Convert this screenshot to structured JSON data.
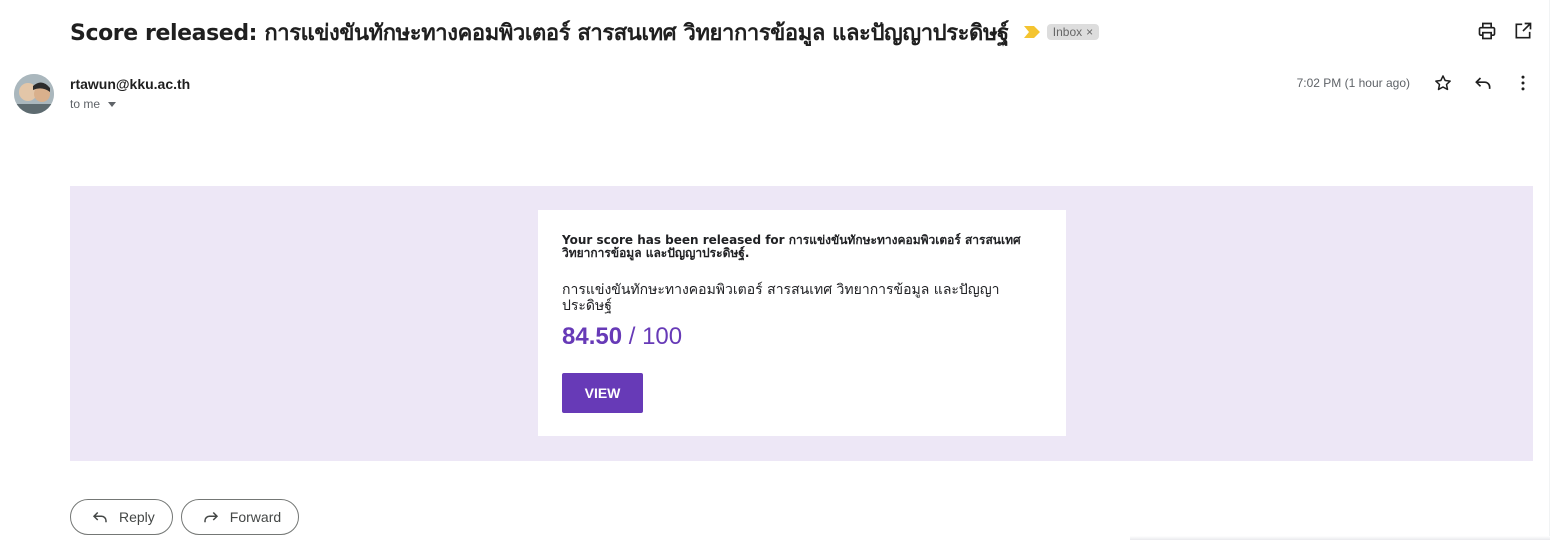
{
  "email": {
    "subject": "Score released: การแข่งขันทักษะทางคอมพิวเตอร์ สารสนเทศ วิทยาการข้อมูล และปัญญาประดิษฐ์",
    "label_chip": "Inbox",
    "label_remove": "×",
    "sender": "rtawun@kku.ac.th",
    "recipient_line": "to me",
    "timestamp": "7:02 PM (1 hour ago)"
  },
  "card": {
    "message": "Your score has been released for การแข่งขันทักษะทางคอมพิวเตอร์ สารสนเทศ วิทยาการข้อมูล และปัญญาประดิษฐ์.",
    "form_title": "การแข่งขันทักษะทางคอมพิวเตอร์ สารสนเทศ วิทยาการข้อมูล และปัญญาประดิษฐ์",
    "score": "84.50",
    "score_total": " / 100",
    "view_label": "VIEW"
  },
  "actions": {
    "reply_label": "Reply",
    "forward_label": "Forward"
  },
  "icons": {
    "importance": "importance-marker-icon",
    "print": "print-icon",
    "open_new": "open-in-new-window-icon",
    "star": "star-icon",
    "reply": "reply-icon",
    "more": "more-vert-icon",
    "forward": "forward-icon"
  },
  "colors": {
    "accent": "#673ab7",
    "banner_bg": "#ede7f6",
    "importance": "#f4c430"
  }
}
